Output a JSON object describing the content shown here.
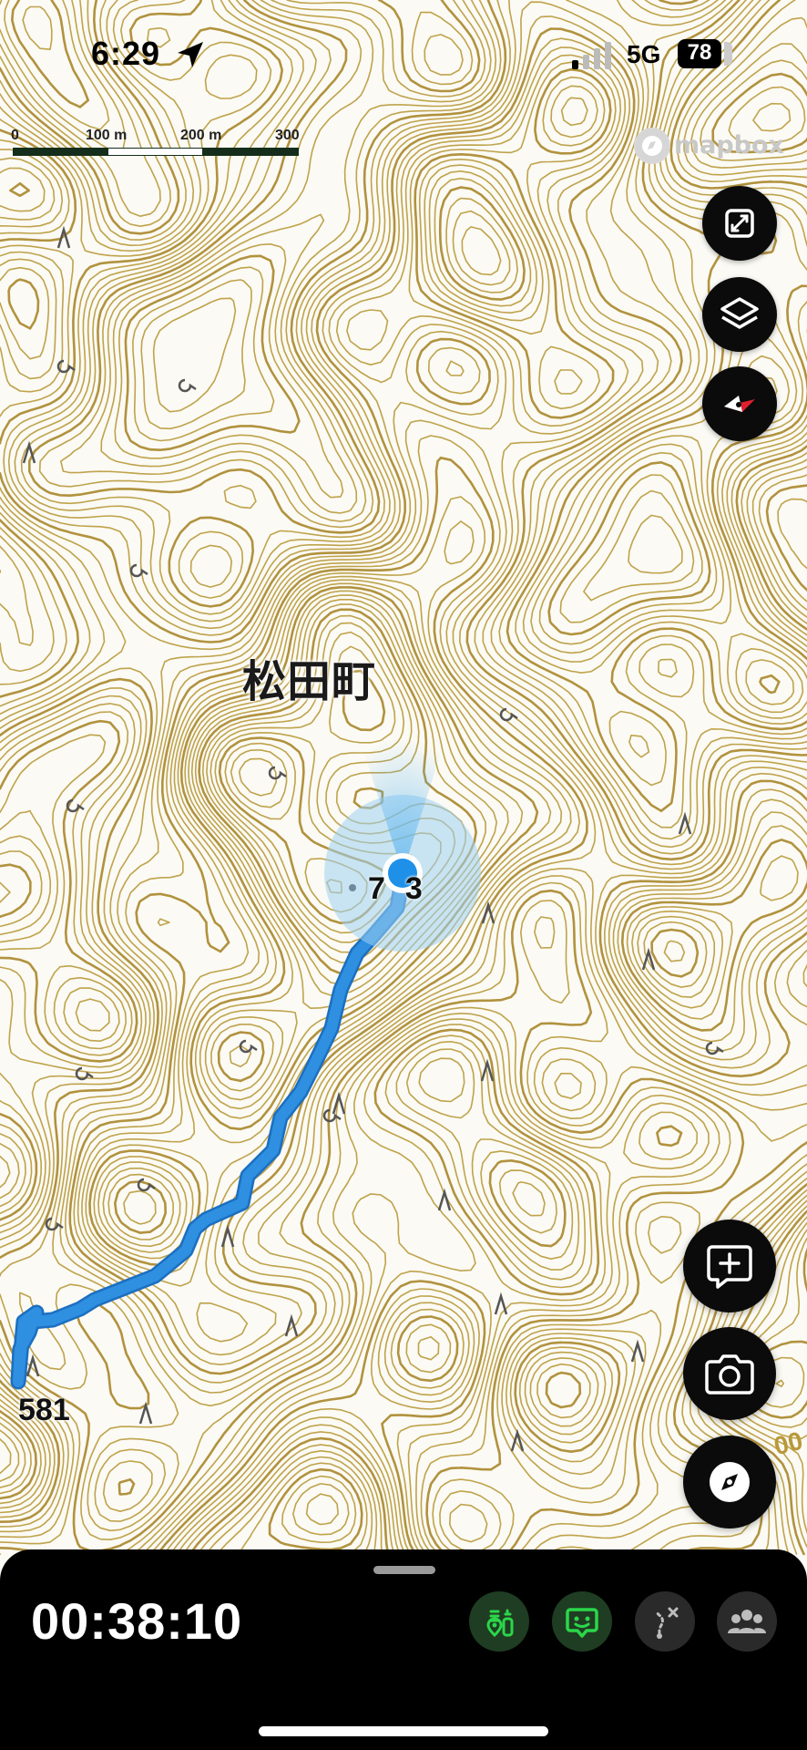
{
  "status_bar": {
    "time": "6:29",
    "network": "5G",
    "battery": "78"
  },
  "scale_bar": {
    "labels": [
      "0",
      "100 m",
      "200 m",
      "300 m"
    ]
  },
  "attribution": {
    "text": "mapbox"
  },
  "map": {
    "place_name": "松田町",
    "summit_elevation": "7",
    "summit_elevation_suffix": "3",
    "spot_elevation": "581",
    "edge_label": "00"
  },
  "colors": {
    "contour": "#b8993a",
    "contour_index": "#a8862a",
    "track": "#2f8fe0",
    "location": "#1e90e8",
    "accuracy": "#9fd1f2",
    "panel": "#000000",
    "active_green": "#2bd64a"
  },
  "map_controls": {
    "icons": [
      "fullscreen-icon",
      "layers-icon",
      "compass-heading-icon"
    ]
  },
  "action_buttons": {
    "icons": [
      "add-note-icon",
      "camera-icon",
      "compass-icon"
    ]
  },
  "recording_panel": {
    "elapsed_time": "00:38:10",
    "icons": [
      "trail-markers-icon",
      "chat-bubble-icon",
      "route-off-icon",
      "group-icon"
    ]
  }
}
